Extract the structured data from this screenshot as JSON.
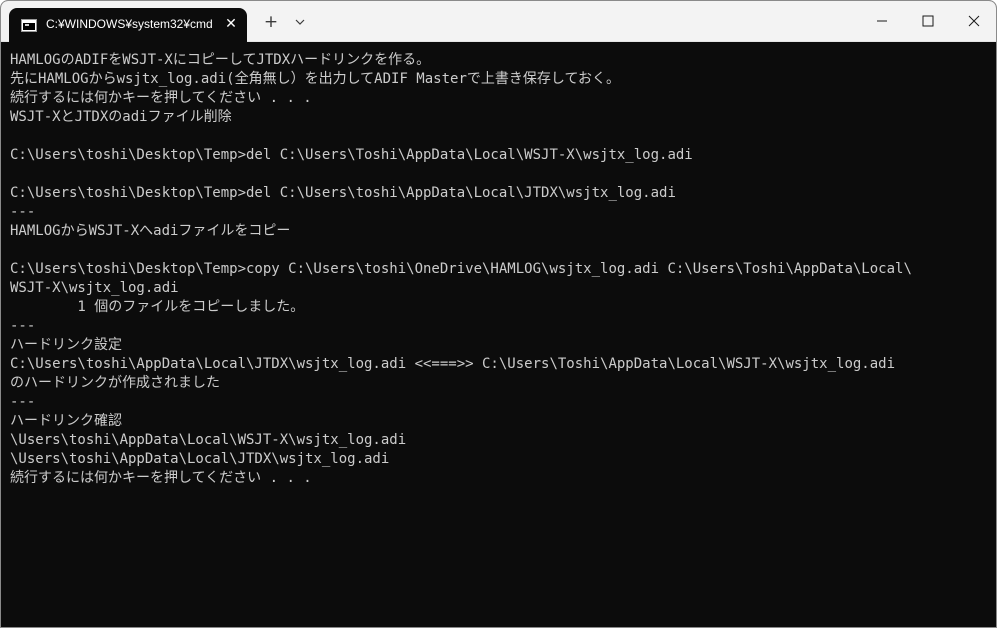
{
  "window": {
    "tab_title": "C:¥WINDOWS¥system32¥cmd",
    "tab_icon": "cmd-icon",
    "close_tab_glyph": "✕",
    "new_tab_glyph": "+",
    "colors": {
      "titlebar": "#f3f3f3",
      "console_bg": "#0c0c0c",
      "console_text": "#cccccc"
    }
  },
  "console": {
    "lines": [
      "HAMLOGのADIFをWSJT-XにコピーしてJTDXハードリンクを作る。",
      "先にHAMLOGからwsjtx_log.adi(全角無し）を出力してADIF Masterで上書き保存しておく。",
      "続行するには何かキーを押してください . . .",
      "WSJT-XとJTDXのadiファイル削除",
      "",
      "C:\\Users\\toshi\\Desktop\\Temp>del C:\\Users\\Toshi\\AppData\\Local\\WSJT-X\\wsjtx_log.adi",
      "",
      "C:\\Users\\toshi\\Desktop\\Temp>del C:\\Users\\toshi\\AppData\\Local\\JTDX\\wsjtx_log.adi",
      "---",
      "HAMLOGからWSJT-Xへadiファイルをコピー",
      "",
      "C:\\Users\\toshi\\Desktop\\Temp>copy C:\\Users\\toshi\\OneDrive\\HAMLOG\\wsjtx_log.adi C:\\Users\\Toshi\\AppData\\Local\\",
      "WSJT-X\\wsjtx_log.adi",
      "        1 個のファイルをコピーしました。",
      "---",
      "ハードリンク設定",
      "C:\\Users\\toshi\\AppData\\Local\\JTDX\\wsjtx_log.adi <<===>> C:\\Users\\Toshi\\AppData\\Local\\WSJT-X\\wsjtx_log.adi",
      "のハードリンクが作成されました",
      "---",
      "ハードリンク確認",
      "\\Users\\toshi\\AppData\\Local\\WSJT-X\\wsjtx_log.adi",
      "\\Users\\toshi\\AppData\\Local\\JTDX\\wsjtx_log.adi",
      "続行するには何かキーを押してください . . ."
    ]
  }
}
